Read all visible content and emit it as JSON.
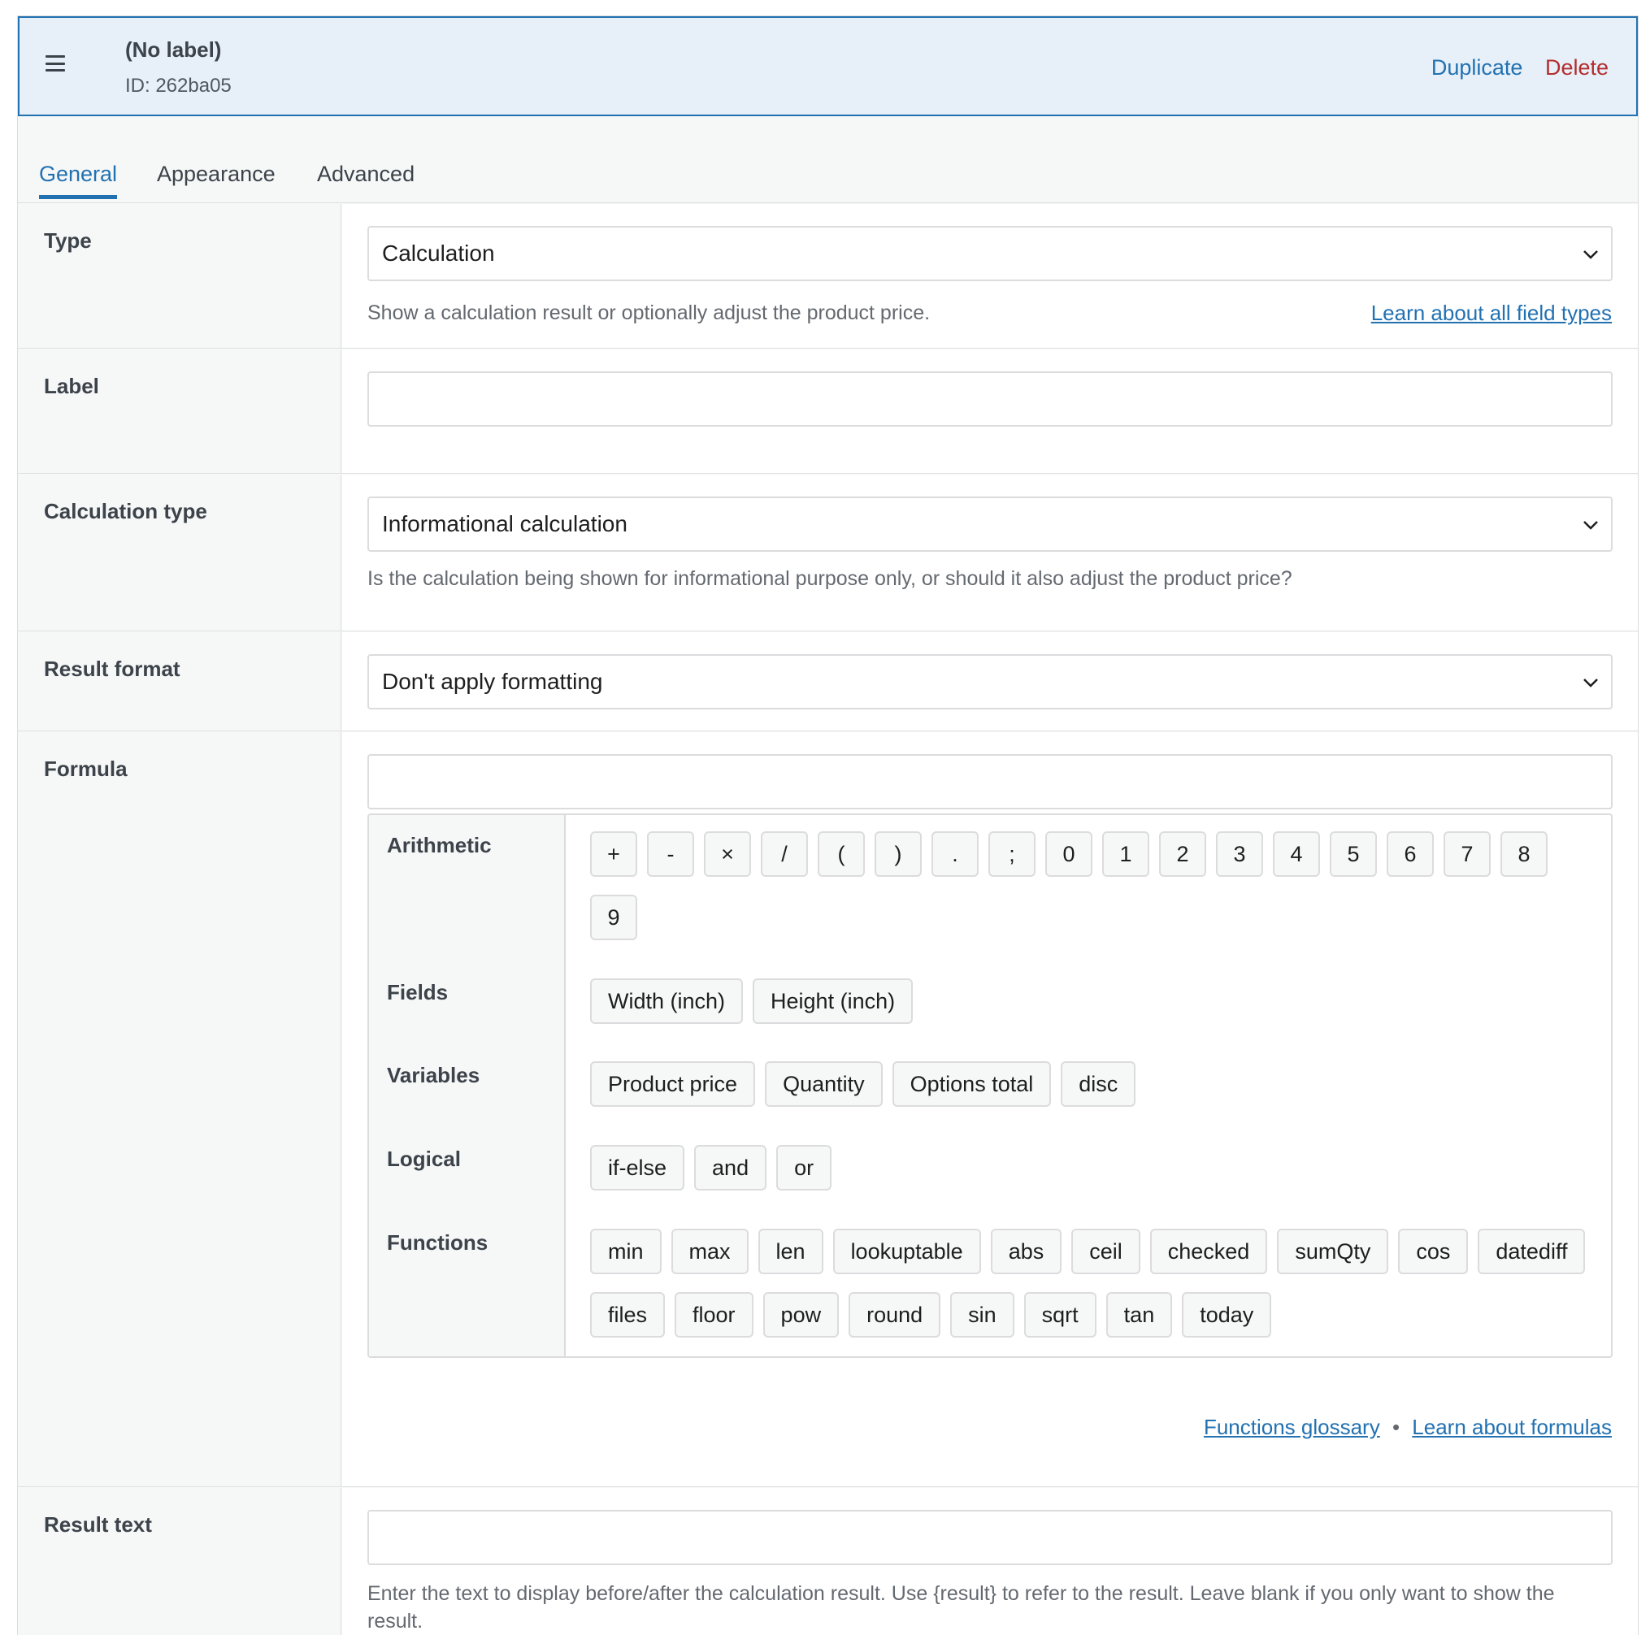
{
  "header": {
    "title": "(No label)",
    "id_text": "ID: 262ba05",
    "duplicate": "Duplicate",
    "delete": "Delete",
    "menu_icon": "hamburger-icon"
  },
  "tabs": [
    {
      "label": "General",
      "active": true
    },
    {
      "label": "Appearance",
      "active": false
    },
    {
      "label": "Advanced",
      "active": false
    }
  ],
  "rows": {
    "type": {
      "label": "Type",
      "value": "Calculation",
      "help": "Show a calculation result or optionally adjust the product price.",
      "link": "Learn about all field types"
    },
    "label_field": {
      "label": "Label",
      "value": ""
    },
    "calc_type": {
      "label": "Calculation type",
      "value": "Informational calculation",
      "help": "Is the calculation being shown for informational purpose only, or should it also adjust the product price?"
    },
    "result_format": {
      "label": "Result format",
      "value": "Don't apply formatting"
    },
    "formula": {
      "label": "Formula",
      "value": "",
      "groups": {
        "arithmetic": {
          "label": "Arithmetic",
          "items": [
            "+",
            "-",
            "×",
            "/",
            "(",
            ")",
            ".",
            ";",
            "0",
            "1",
            "2",
            "3",
            "4",
            "5",
            "6",
            "7",
            "8",
            "9"
          ]
        },
        "fields": {
          "label": "Fields",
          "items": [
            "Width (inch)",
            "Height (inch)"
          ]
        },
        "variables": {
          "label": "Variables",
          "items": [
            "Product price",
            "Quantity",
            "Options total",
            "disc"
          ]
        },
        "logical": {
          "label": "Logical",
          "items": [
            "if-else",
            "and",
            "or"
          ]
        },
        "functions": {
          "label": "Functions",
          "items": [
            "min",
            "max",
            "len",
            "lookuptable",
            "abs",
            "ceil",
            "checked",
            "sumQty",
            "cos",
            "datediff",
            "files",
            "floor",
            "pow",
            "round",
            "sin",
            "sqrt",
            "tan",
            "today"
          ]
        }
      },
      "links": {
        "glossary": "Functions glossary",
        "separator": "•",
        "formulas": "Learn about formulas"
      }
    },
    "result_text": {
      "label": "Result text",
      "value": "",
      "help": "Enter the text to display before/after the calculation result. Use {result} to refer to the result. Leave blank if you only want to show the result."
    }
  },
  "colors": {
    "accent": "#2271b1",
    "danger": "#b32d2e",
    "header_bg": "#e7f0f8"
  }
}
